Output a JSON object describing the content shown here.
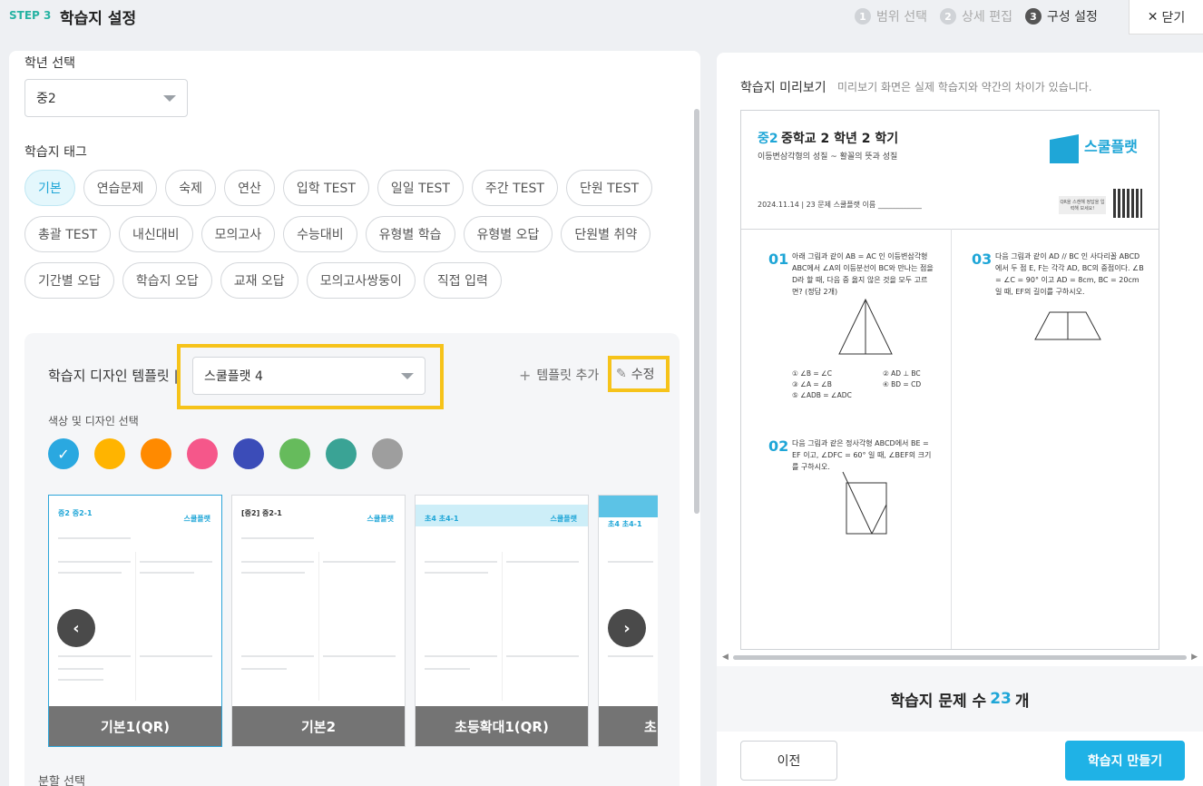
{
  "header": {
    "step_label": "STEP 3",
    "title": "학습지 설정",
    "steps": [
      {
        "num": "1",
        "label": "범위 선택"
      },
      {
        "num": "2",
        "label": "상세 편집"
      },
      {
        "num": "3",
        "label": "구성 설정"
      }
    ],
    "close_label": "닫기"
  },
  "left": {
    "grade_label": "학년 선택",
    "grade_value": "중2",
    "tag_label": "학습지 태그",
    "tags": [
      "기본",
      "연습문제",
      "숙제",
      "연산",
      "입학 TEST",
      "일일 TEST",
      "주간 TEST",
      "단원 TEST",
      "총괄 TEST",
      "내신대비",
      "모의고사",
      "수능대비",
      "유형별 학습",
      "유형별 오답",
      "단원별 취약",
      "기간별 오답",
      "학습지 오답",
      "교재 오답",
      "모의고사쌍둥이",
      "직접 입력"
    ],
    "selected_tag": "기본",
    "design": {
      "title": "학습지 디자인 템플릿 |",
      "template_value": "스쿨플랫 4",
      "add_label": "템플릿 추가",
      "edit_label": "수정",
      "color_label": "색상 및 디자인 선택",
      "colors": [
        "#2aa8e0",
        "#ffb400",
        "#ff8a00",
        "#f5578a",
        "#3b4cb8",
        "#66bb5c",
        "#3aa395",
        "#9e9e9e"
      ],
      "selected_color": 0,
      "cards": [
        {
          "name": "기본1(QR)",
          "header": "중2 중2-1",
          "brand": "스쿨플랫"
        },
        {
          "name": "기본2",
          "header": "[중2] 중2-1",
          "brand": "스쿨플랫"
        },
        {
          "name": "초등확대1(QR)",
          "header": "초4 초4-1",
          "brand": "스쿨플랫"
        },
        {
          "name": "초",
          "header": "초4 초4-1",
          "brand": ""
        }
      ],
      "prev_arrow": "‹",
      "next_arrow": "›"
    },
    "split_label": "분할 선택"
  },
  "right": {
    "preview_title": "학습지 미리보기",
    "preview_sub": "미리보기 화면은 실제 학습지와 약간의 차이가 있습니다.",
    "sheet": {
      "grade": "중2",
      "title": "중학교 2 학년 2 학기",
      "subtitle": "이등변삼각형의 성질 ~ 활꼴의 뜻과 성질",
      "brand": "스쿨플랫",
      "meta": "2024.11.14 | 23 문제 스쿨플랫 이름 ____________",
      "qr_note": "QR을 스캔해 정답을 입력해 보세요!",
      "questions": [
        {
          "num": "01",
          "text": "아래 그림과 같이 AB = AC 인 이등변삼각형 ABC에서 ∠A의 이등분선이 BC와 만나는 점을 D라 할 때, 다음 중 옳지 않은 것을 모두 고르면? (정답 2개)",
          "choices": [
            "① ∠B = ∠C",
            "② AD ⊥ BC",
            "③ ∠A = ∠B",
            "④ BD = CD",
            "⑤ ∠ADB = ∠ADC"
          ]
        },
        {
          "num": "02",
          "text": "다음 그림과 같은 정사각형 ABCD에서 BE = EF 이고, ∠DFC = 60° 일 때, ∠BEF의 크기를 구하시오."
        },
        {
          "num": "03",
          "text": "다음 그림과 같이 AD // BC 인 사다리꼴 ABCD에서 두 점 E, F는 각각 AD, BC의 중점이다. ∠B = ∠C = 90° 이고 AD = 8cm, BC = 20cm 일 때, EF의 길이를 구하시오."
        }
      ]
    },
    "count_prefix": "학습지 문제 수",
    "count_value": "23",
    "count_suffix": "개",
    "prev_label": "이전",
    "make_label": "학습지 만들기"
  }
}
